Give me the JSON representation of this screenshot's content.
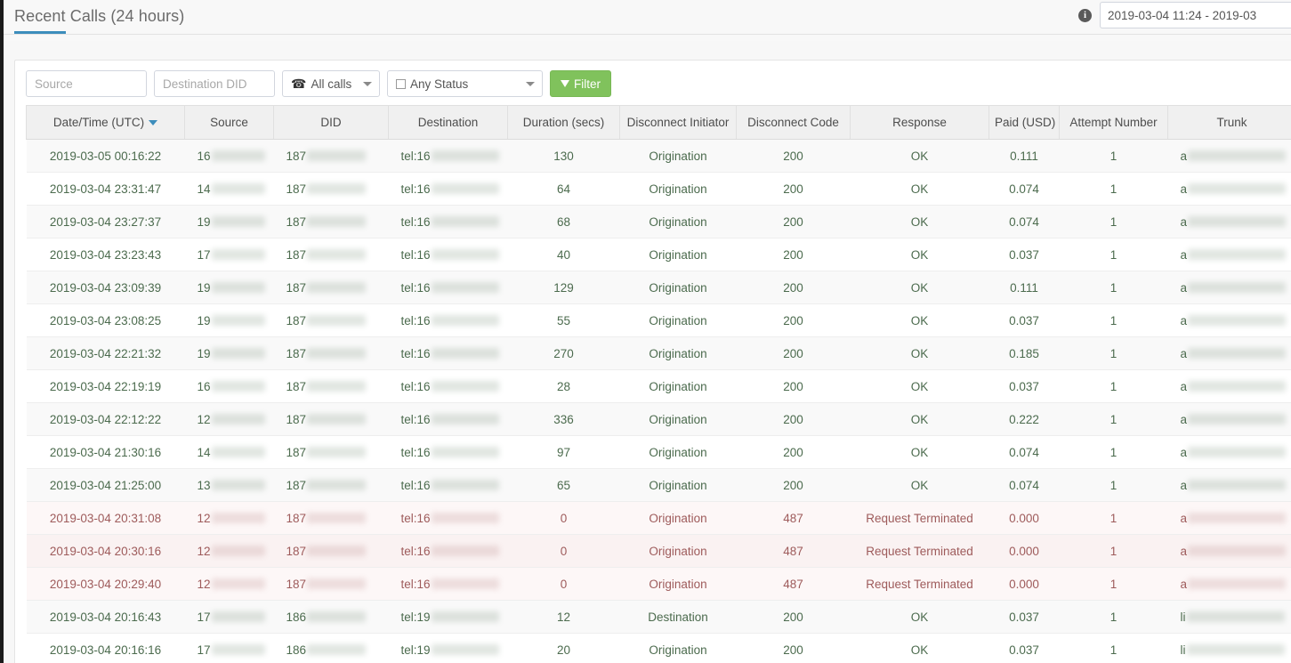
{
  "header": {
    "title": "Recent Calls (24 hours)",
    "info_icon": "info-icon",
    "date_range_value": "2019-03-04 11:24 - 2019-03",
    "accent_color": "#3c8dbc"
  },
  "filters": {
    "source_placeholder": "Source",
    "source_value": "",
    "destination_did_placeholder": "Destination DID",
    "destination_did_value": "",
    "call_type_label": "All calls",
    "call_type_icon": "phone-icon",
    "status_label": "Any Status",
    "status_checkbox_checked": false,
    "filter_button_label": "Filter",
    "filter_button_icon": "funnel-icon",
    "filter_button_color": "#80c25c"
  },
  "table": {
    "sort_column": "Date/Time (UTC)",
    "sort_direction": "desc",
    "columns": [
      "Date/Time (UTC)",
      "Source",
      "DID",
      "Destination",
      "Duration (secs)",
      "Disconnect Initiator",
      "Disconnect Code",
      "Response",
      "Paid (USD)",
      "Attempt Number",
      "Trunk"
    ],
    "rows": [
      {
        "datetime": "2019-03-05 00:16:22",
        "source": "16",
        "did": "187",
        "destination": "tel:16",
        "duration": "130",
        "initiator": "Origination",
        "code": "200",
        "response": "OK",
        "paid": "0.111",
        "attempt": "1",
        "trunk": "a",
        "error": false
      },
      {
        "datetime": "2019-03-04 23:31:47",
        "source": "14",
        "did": "187",
        "destination": "tel:16",
        "duration": "64",
        "initiator": "Origination",
        "code": "200",
        "response": "OK",
        "paid": "0.074",
        "attempt": "1",
        "trunk": "a",
        "error": false
      },
      {
        "datetime": "2019-03-04 23:27:37",
        "source": "19",
        "did": "187",
        "destination": "tel:16",
        "duration": "68",
        "initiator": "Origination",
        "code": "200",
        "response": "OK",
        "paid": "0.074",
        "attempt": "1",
        "trunk": "a",
        "error": false
      },
      {
        "datetime": "2019-03-04 23:23:43",
        "source": "17",
        "did": "187",
        "destination": "tel:16",
        "duration": "40",
        "initiator": "Origination",
        "code": "200",
        "response": "OK",
        "paid": "0.037",
        "attempt": "1",
        "trunk": "a",
        "error": false
      },
      {
        "datetime": "2019-03-04 23:09:39",
        "source": "19",
        "did": "187",
        "destination": "tel:16",
        "duration": "129",
        "initiator": "Origination",
        "code": "200",
        "response": "OK",
        "paid": "0.111",
        "attempt": "1",
        "trunk": "a",
        "error": false
      },
      {
        "datetime": "2019-03-04 23:08:25",
        "source": "19",
        "did": "187",
        "destination": "tel:16",
        "duration": "55",
        "initiator": "Origination",
        "code": "200",
        "response": "OK",
        "paid": "0.037",
        "attempt": "1",
        "trunk": "a",
        "error": false
      },
      {
        "datetime": "2019-03-04 22:21:32",
        "source": "19",
        "did": "187",
        "destination": "tel:16",
        "duration": "270",
        "initiator": "Origination",
        "code": "200",
        "response": "OK",
        "paid": "0.185",
        "attempt": "1",
        "trunk": "a",
        "error": false
      },
      {
        "datetime": "2019-03-04 22:19:19",
        "source": "16",
        "did": "187",
        "destination": "tel:16",
        "duration": "28",
        "initiator": "Origination",
        "code": "200",
        "response": "OK",
        "paid": "0.037",
        "attempt": "1",
        "trunk": "a",
        "error": false
      },
      {
        "datetime": "2019-03-04 22:12:22",
        "source": "12",
        "did": "187",
        "destination": "tel:16",
        "duration": "336",
        "initiator": "Origination",
        "code": "200",
        "response": "OK",
        "paid": "0.222",
        "attempt": "1",
        "trunk": "a",
        "error": false
      },
      {
        "datetime": "2019-03-04 21:30:16",
        "source": "14",
        "did": "187",
        "destination": "tel:16",
        "duration": "97",
        "initiator": "Origination",
        "code": "200",
        "response": "OK",
        "paid": "0.074",
        "attempt": "1",
        "trunk": "a",
        "error": false
      },
      {
        "datetime": "2019-03-04 21:25:00",
        "source": "13",
        "did": "187",
        "destination": "tel:16",
        "duration": "65",
        "initiator": "Origination",
        "code": "200",
        "response": "OK",
        "paid": "0.074",
        "attempt": "1",
        "trunk": "a",
        "error": false
      },
      {
        "datetime": "2019-03-04 20:31:08",
        "source": "12",
        "did": "187",
        "destination": "tel:16",
        "duration": "0",
        "initiator": "Origination",
        "code": "487",
        "response": "Request Terminated",
        "paid": "0.000",
        "attempt": "1",
        "trunk": "a",
        "error": true
      },
      {
        "datetime": "2019-03-04 20:30:16",
        "source": "12",
        "did": "187",
        "destination": "tel:16",
        "duration": "0",
        "initiator": "Origination",
        "code": "487",
        "response": "Request Terminated",
        "paid": "0.000",
        "attempt": "1",
        "trunk": "a",
        "error": true
      },
      {
        "datetime": "2019-03-04 20:29:40",
        "source": "12",
        "did": "187",
        "destination": "tel:16",
        "duration": "0",
        "initiator": "Origination",
        "code": "487",
        "response": "Request Terminated",
        "paid": "0.000",
        "attempt": "1",
        "trunk": "a",
        "error": true
      },
      {
        "datetime": "2019-03-04 20:16:43",
        "source": "17",
        "did": "186",
        "destination": "tel:19",
        "duration": "12",
        "initiator": "Destination",
        "code": "200",
        "response": "OK",
        "paid": "0.037",
        "attempt": "1",
        "trunk": "li",
        "error": false
      },
      {
        "datetime": "2019-03-04 20:16:16",
        "source": "17",
        "did": "186",
        "destination": "tel:19",
        "duration": "20",
        "initiator": "Origination",
        "code": "200",
        "response": "OK",
        "paid": "0.037",
        "attempt": "1",
        "trunk": "li",
        "error": false
      }
    ]
  }
}
